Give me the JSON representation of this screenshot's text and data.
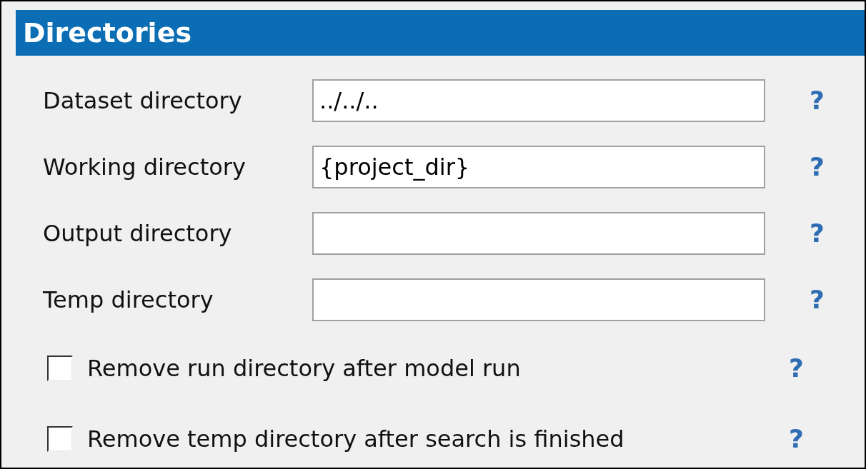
{
  "section": {
    "title": "Directories"
  },
  "fields": [
    {
      "label": "Dataset directory",
      "value": "../../..",
      "help": "?"
    },
    {
      "label": "Working directory",
      "value": "{project_dir}",
      "help": "?"
    },
    {
      "label": "Output directory",
      "help": "?"
    },
    {
      "label": "Temp directory",
      "help": "?"
    }
  ],
  "options": [
    {
      "label": "Remove run directory after model run",
      "checked": false,
      "help": "?"
    },
    {
      "label": "Remove temp directory after search is finished",
      "checked": false,
      "help": "?"
    }
  ]
}
